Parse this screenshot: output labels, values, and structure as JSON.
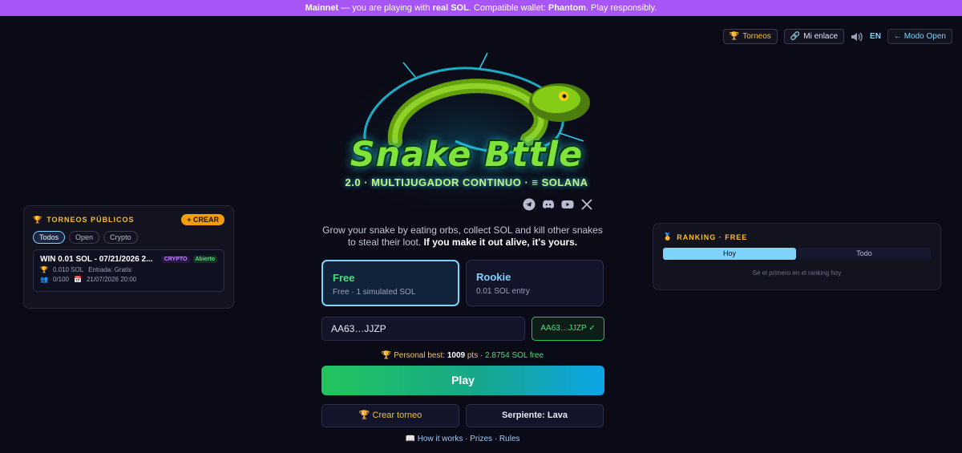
{
  "banner": {
    "network": "Mainnet",
    "text1": " — you are playing with ",
    "real_sol": "real SOL",
    "text2": ". Compatible wallet: ",
    "wallet": "Phantom",
    "text3": ". Play responsibly."
  },
  "toolbar": {
    "tournaments": "Torneos",
    "my_link": "Mi enlace",
    "lang": "EN",
    "mode": "← Modo Open"
  },
  "logo": {
    "title": "Snake Bttle",
    "subtitle": "2.0 · MULTIJUGADOR CONTINUO · ≡ SOLANA"
  },
  "tagline": {
    "text": "Grow your snake by eating orbs, collect SOL and kill other snakes to steal their loot. ",
    "bold": "If you make it out alive, it's yours."
  },
  "modes": [
    {
      "title": "Free",
      "subtitle": "Free · 1 simulated SOL"
    },
    {
      "title": "Rookie",
      "subtitle": "0.01 SOL entry"
    }
  ],
  "wallet": {
    "value": "AA63…JJZP",
    "status": "AA63…JJZP ✓"
  },
  "best": {
    "label": "Personal best: ",
    "pts": "1009",
    "pts_unit": " pts · ",
    "sol": "2.8754 SOL free"
  },
  "play_label": "Play",
  "create_tournament": "Crear torneo",
  "snake_label": "Serpiente: Lava",
  "footer_links": "How it works · Prizes · Rules",
  "public_tournaments": {
    "title": "TORNEOS PÚBLICOS",
    "create": "+ CREAR",
    "filters": [
      "Todos",
      "Open",
      "Crypto"
    ],
    "card": {
      "name": "WIN 0.01 SOL - 07/21/2026 2...",
      "type": "CRYPTO",
      "status": "Abierto",
      "prize": "0.010 SOL",
      "entry": "Entrada: Gratis",
      "players": "0/100",
      "date": "21/07/2026 20:00"
    }
  },
  "ranking": {
    "title": "RANKING · FREE",
    "tabs": [
      "Hoy",
      "Todo"
    ],
    "empty": "Sé el primero en el ranking hoy"
  },
  "colors": {
    "banner": "#a855f7",
    "accent": "#7dd3fc",
    "green": "#4ade80",
    "gold": "#fbbf24"
  }
}
